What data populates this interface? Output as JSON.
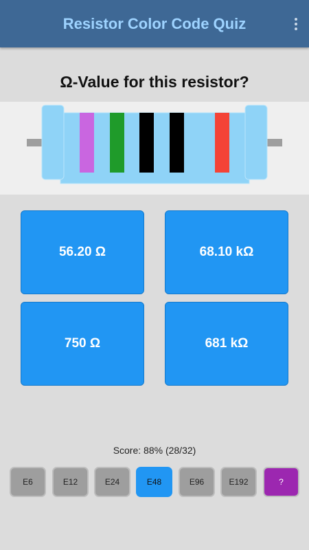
{
  "appbar": {
    "title": "Resistor Color Code Quiz",
    "menu_icon": "more-vert-icon"
  },
  "question": "Ω-Value for this resistor?",
  "resistor": {
    "body_color": "#8fd3f7",
    "lead_color": "#9e9e9e",
    "bands": [
      {
        "name": "violet",
        "color": "#c966e0"
      },
      {
        "name": "green",
        "color": "#1f9b2a"
      },
      {
        "name": "black",
        "color": "#000000"
      },
      {
        "name": "black",
        "color": "#000000"
      },
      {
        "name": "red",
        "color": "#f44336"
      }
    ]
  },
  "answers": [
    {
      "label": "56.20 Ω"
    },
    {
      "label": "68.10 kΩ"
    },
    {
      "label": "750 Ω"
    },
    {
      "label": "681 kΩ"
    }
  ],
  "score": "Score: 88% (28/32)",
  "series": [
    {
      "label": "E6",
      "state": "normal"
    },
    {
      "label": "E12",
      "state": "normal"
    },
    {
      "label": "E24",
      "state": "normal"
    },
    {
      "label": "E48",
      "state": "active"
    },
    {
      "label": "E96",
      "state": "normal"
    },
    {
      "label": "E192",
      "state": "normal"
    },
    {
      "label": "?",
      "state": "help"
    }
  ],
  "colors": {
    "appbar": "#3e6895",
    "title_text": "#9ed3ff",
    "answer_button": "#2196f3",
    "series_button": "#9e9e9e",
    "help_button": "#9c27b0"
  }
}
